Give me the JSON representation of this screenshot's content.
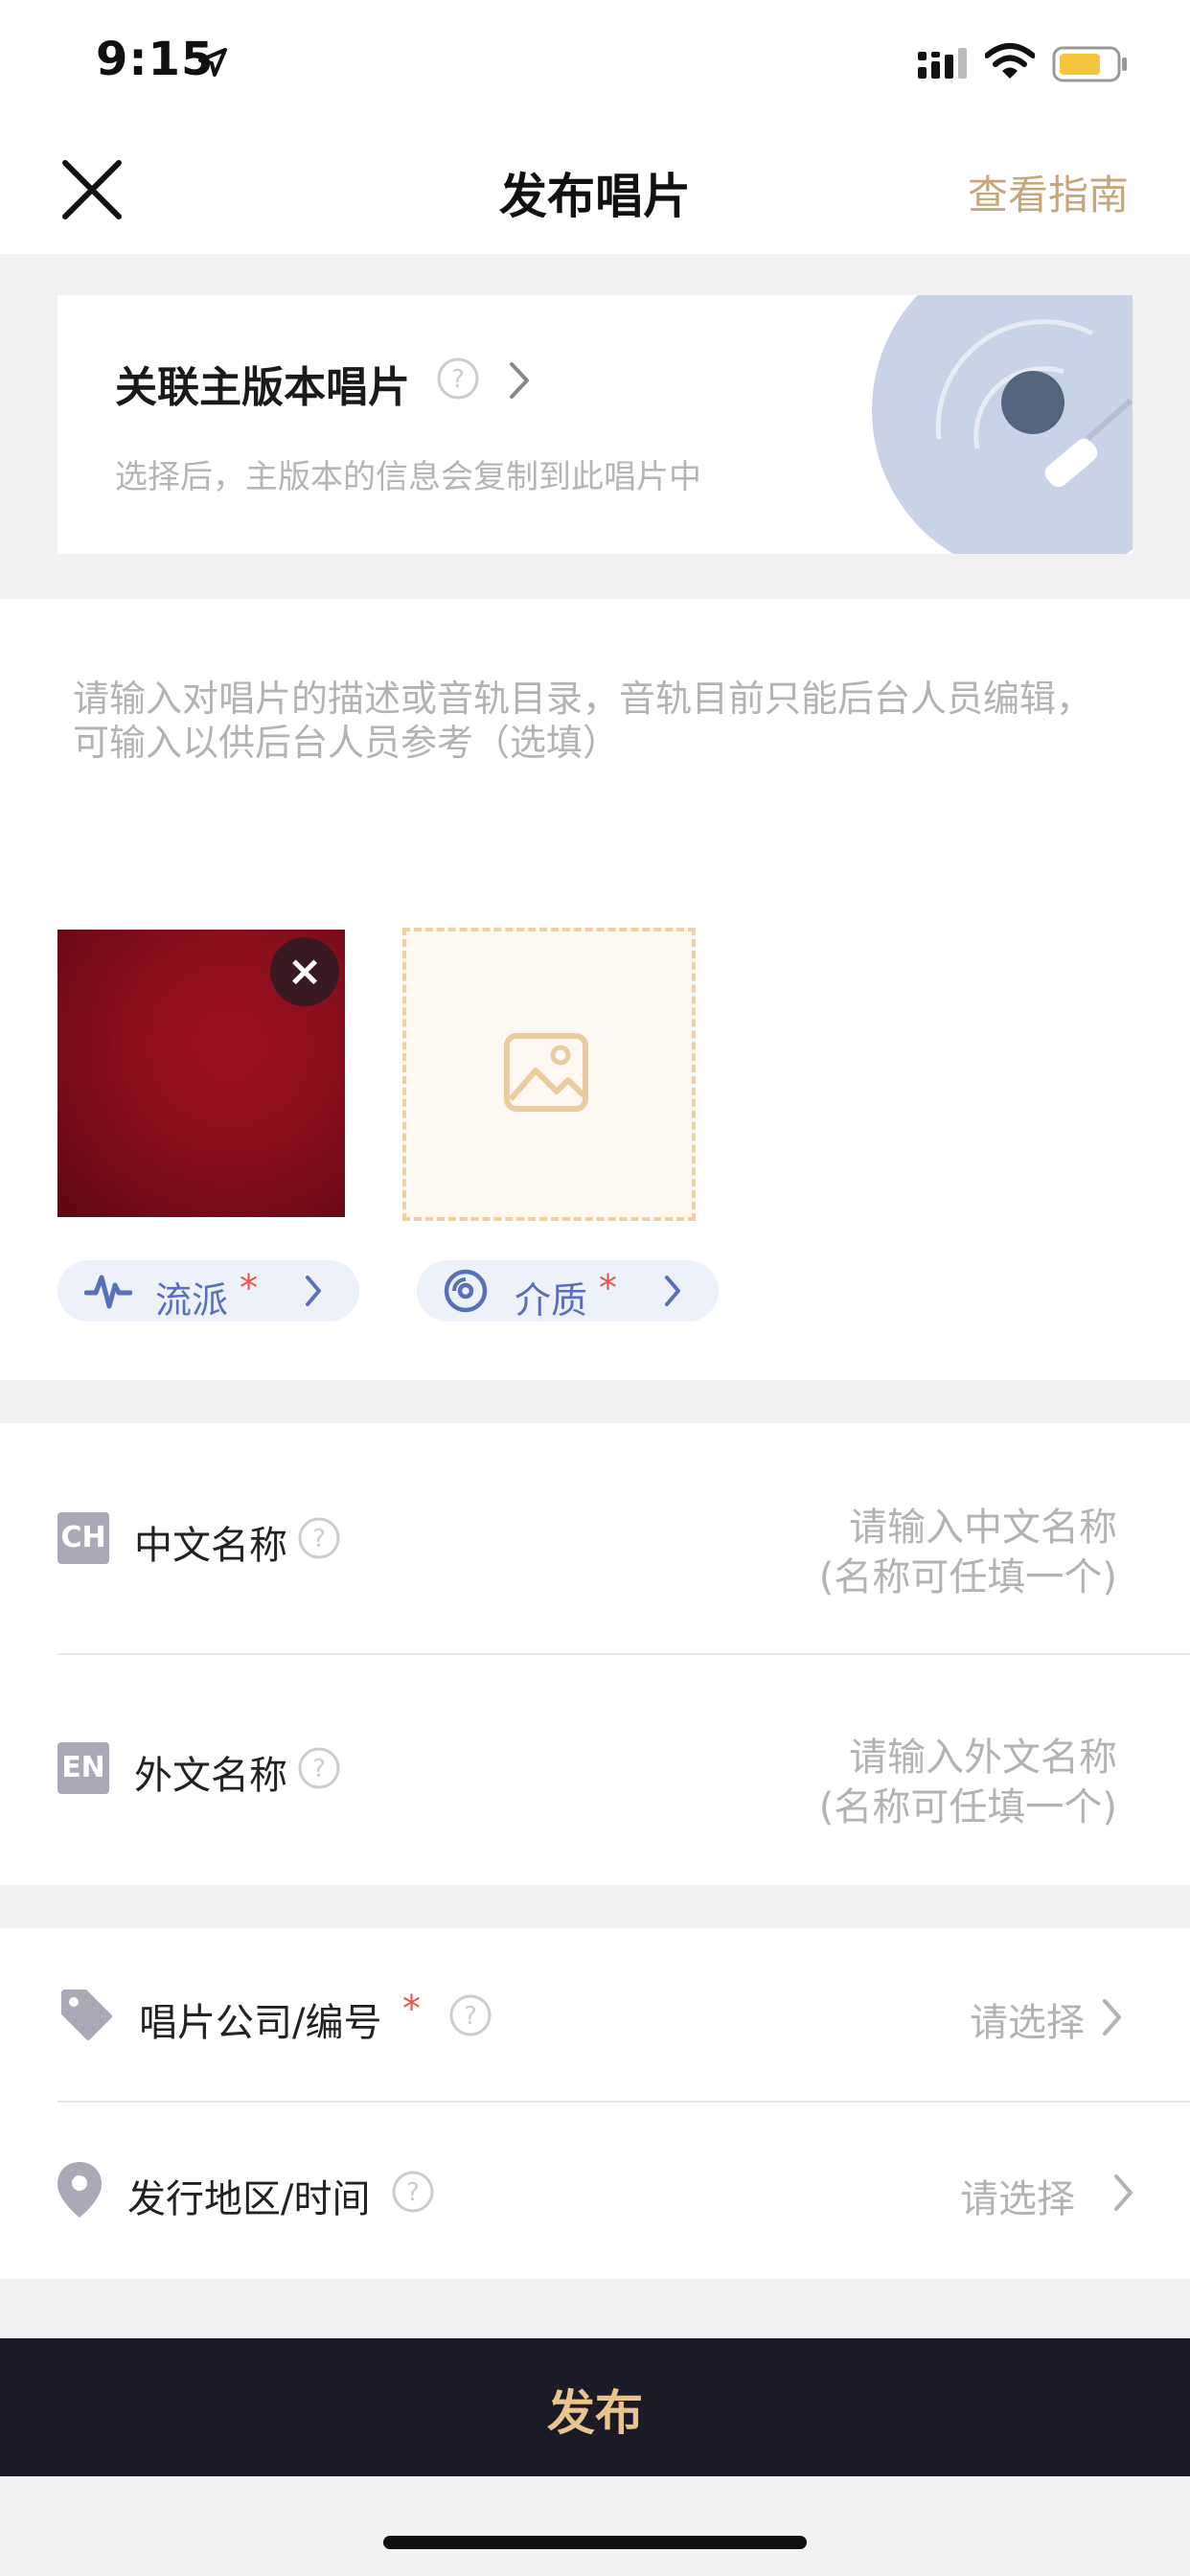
{
  "status_bar": {
    "time": "9:15"
  },
  "nav": {
    "title": "发布唱片",
    "guide": "查看指南"
  },
  "master_card": {
    "title": "关联主版本唱片",
    "subtitle": "选择后，主版本的信息会复制到此唱片中"
  },
  "description": {
    "placeholder": "请输入对唱片的描述或音轨目录，音轨目前只能后台人员编辑，可输入以供后台人员参考（选填）"
  },
  "chips": [
    {
      "label": "流派",
      "required_mark": "*",
      "icon": "waveform-icon"
    },
    {
      "label": "介质",
      "required_mark": "*",
      "icon": "vinyl-disc-icon"
    }
  ],
  "names": [
    {
      "badge": "CH",
      "label": "中文名称",
      "placeholder_line1": "请输入中文名称",
      "placeholder_line2": "(名称可任填一个)"
    },
    {
      "badge": "EN",
      "label": "外文名称",
      "placeholder_line1": "请输入外文名称",
      "placeholder_line2": "(名称可任填一个)"
    }
  ],
  "selects": [
    {
      "label": "唱片公司/编号",
      "required_mark": "*",
      "value": "请选择",
      "icon": "tag-icon"
    },
    {
      "label": "发行地区/时间",
      "value": "请选择",
      "icon": "location-pin-icon"
    }
  ],
  "publish": {
    "label": "发布"
  },
  "colors": {
    "accent": "#c8a67c",
    "publish_bg": "#1a1b26",
    "publish_text": "#e9c58e",
    "chip_text": "#5870b8",
    "required": "#e2584a"
  }
}
